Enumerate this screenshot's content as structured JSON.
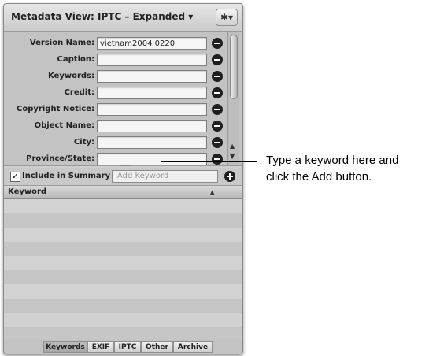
{
  "panel": {
    "title": "Metadata View: IPTC – Expanded ▾",
    "gear_glyph": "✱▾"
  },
  "fields": [
    {
      "label": "Version Name:",
      "value": "vietnam2004 0220"
    },
    {
      "label": "Caption:",
      "value": ""
    },
    {
      "label": "Keywords:",
      "value": ""
    },
    {
      "label": "Credit:",
      "value": ""
    },
    {
      "label": "Copyright Notice:",
      "value": ""
    },
    {
      "label": "Object Name:",
      "value": ""
    },
    {
      "label": "City:",
      "value": ""
    },
    {
      "label": "Province/State:",
      "value": ""
    }
  ],
  "keyword_bar": {
    "checkbox_glyph": "✓",
    "include_label": "Include in Summary",
    "add_placeholder": "Add Keyword"
  },
  "table": {
    "header": "Keyword",
    "sort_glyph": "▲"
  },
  "tabs": [
    "Keywords",
    "EXIF",
    "IPTC",
    "Other",
    "Archive"
  ],
  "active_tab": "Keywords",
  "scroll_arrows": {
    "up": "▲",
    "down": "▼"
  },
  "callout": {
    "line1": "Type a keyword here and",
    "line2": "click the Add button."
  }
}
